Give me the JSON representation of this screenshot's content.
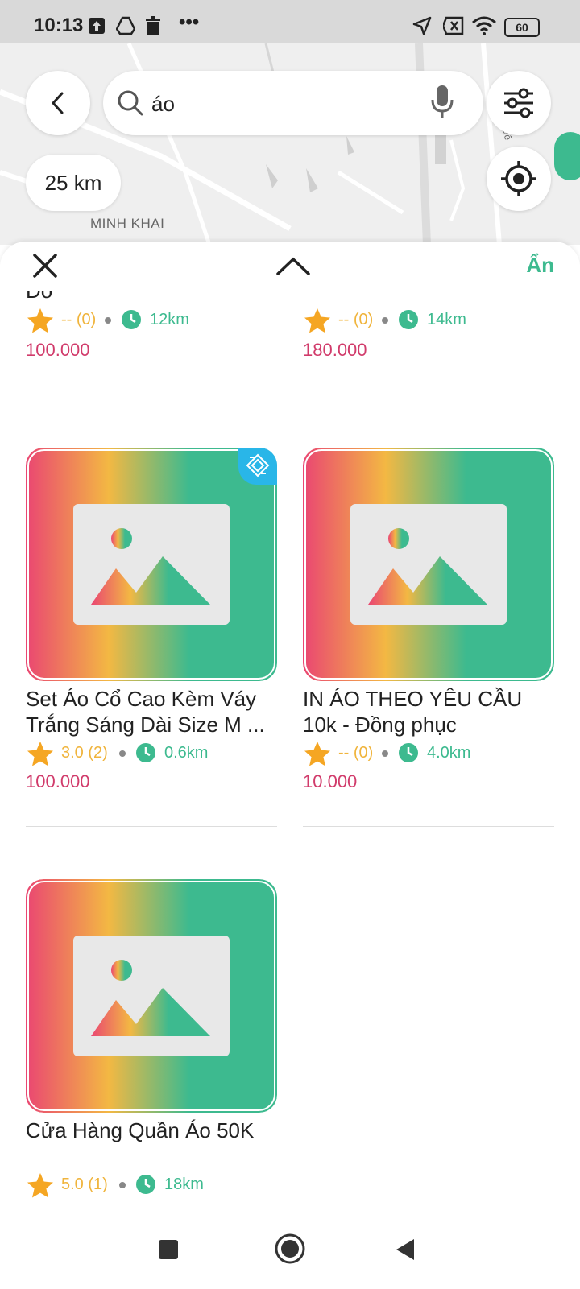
{
  "status_bar": {
    "time": "10:13",
    "battery": "60"
  },
  "map": {
    "label": "MINH KHAI",
    "side_label": "Huế"
  },
  "search": {
    "query": "áo"
  },
  "distance_filter": "25 km",
  "sheet": {
    "hide_label": "Ẩn"
  },
  "products": [
    {
      "name_lines": [
        "Đỏ"
      ],
      "rating": "-- (0)",
      "distance": "12km",
      "price": "100.000"
    },
    {
      "name_lines": [
        ""
      ],
      "rating": "-- (0)",
      "distance": "14km",
      "price": "180.000"
    },
    {
      "name_lines": [
        "Set Áo Cổ Cao Kèm Váy",
        "Trắng Sáng Dài Size M ..."
      ],
      "rating": "3.0 (2)",
      "distance": "0.6km",
      "price": "100.000",
      "badge": true
    },
    {
      "name_lines": [
        "IN ÁO THEO YÊU CẦU",
        "10k - Đồng phục"
      ],
      "rating": "-- (0)",
      "distance": "4.0km",
      "price": "10.000"
    },
    {
      "name_lines": [
        "Cửa Hàng Quần Áo 50K"
      ],
      "rating": "5.0 (1)",
      "distance": "18km",
      "price": ""
    }
  ],
  "colors": {
    "accent": "#3dba8f",
    "price": "#d13b6b",
    "star": "#f5a623",
    "badge": "#29b6e8"
  },
  "icons": [
    "back-arrow-icon",
    "search-icon",
    "mic-icon",
    "filter-sliders-icon",
    "locate-icon",
    "close-icon",
    "chevron-up-icon",
    "star-icon",
    "clock-icon",
    "image-placeholder-icon",
    "badge-icon",
    "square-nav-icon",
    "circle-nav-icon",
    "triangle-back-icon"
  ]
}
